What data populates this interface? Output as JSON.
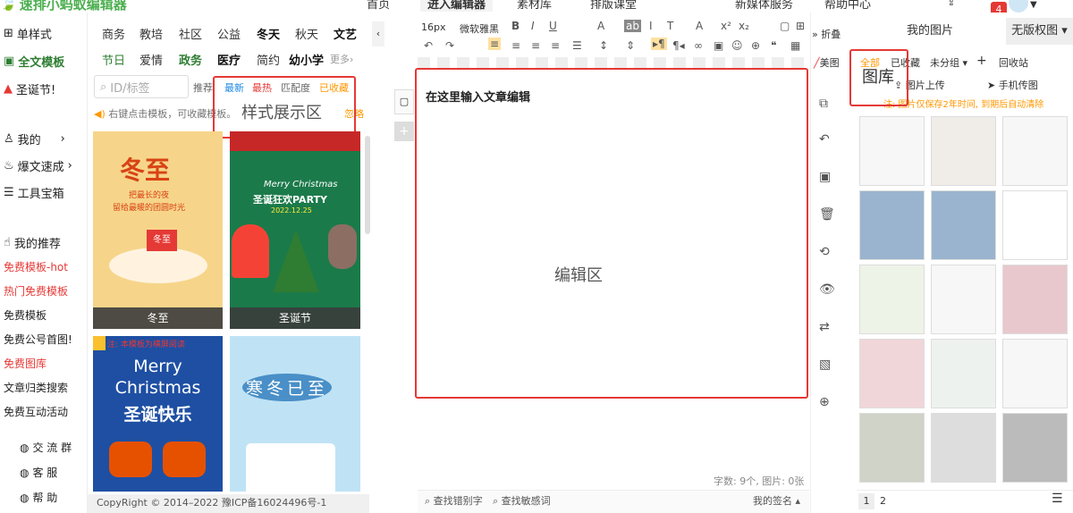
{
  "brand": "速排小蚂蚁编辑器",
  "topnav": [
    "首页",
    "进入编辑器",
    "素材库",
    "排版课堂",
    "新媒体服务",
    "帮助中心"
  ],
  "notif": "4",
  "sidebar": {
    "items": [
      "单样式",
      "全文模板",
      "圣诞节!",
      "我的",
      "爆文速成",
      "工具宝箱",
      "我的推荐",
      "免费模板-hot",
      "热门免费模板",
      "免费模板",
      "免费公号首图!",
      "免费图库",
      "文章归类搜索",
      "免费互动活动",
      "交 流 群",
      "客  服",
      "帮  助"
    ]
  },
  "categories": {
    "row1": [
      "商务",
      "教培",
      "社区",
      "公益",
      "冬天",
      "秋天",
      "文艺"
    ],
    "row2": [
      "节日",
      "爱情",
      "政务",
      "医疗",
      "简约",
      "幼小学",
      "更多"
    ]
  },
  "search": {
    "placeholder": "ID/标签",
    "tabs": [
      "推荐",
      "最新",
      "最热",
      "匹配度",
      "已收藏"
    ]
  },
  "hint": "右键点击模板，可收藏模板。",
  "hint_tail": "忽略",
  "overlay_label_tpl": "样式展示区",
  "cards": [
    {
      "label": "冬至",
      "title": "冬至",
      "sub1": "把最长的夜",
      "sub2": "留给最暖的团圆时光"
    },
    {
      "label": "圣诞节",
      "title": "Merry Christmas",
      "sub1": "圣诞狂欢PARTY",
      "sub2": "2022.12.25"
    },
    {
      "label": "",
      "title": "Merry Christmas",
      "sub1": "圣诞快乐",
      "sub2": "注: 本模板为横屏阅读"
    },
    {
      "label": "",
      "title": "寒冬已至",
      "sub1": "",
      "sub2": ""
    }
  ],
  "copyright": "CopyRight © 2014–2022 豫ICP备16024496号-1",
  "editor": {
    "font_size": "16px",
    "font_family": "微软雅黑",
    "placeholder": "在这里输入文章编辑",
    "overlay_label": "编辑区",
    "count": "字数: 9个, 图片: 0张",
    "find_typo": "查找错别字",
    "find_sensitive": "查找敏感词",
    "signature": "我的签名"
  },
  "tools": {
    "fold": "折叠",
    "meitu": "美图"
  },
  "gallery": {
    "tabs": [
      "我的图片",
      "无版权图"
    ],
    "filters": [
      "全部",
      "已收藏",
      "未分组",
      "回收站"
    ],
    "upload": "图片上传",
    "mobile": "手机传图",
    "notice": "注: 图片仅保存2年时间, 到期后自动清除",
    "overlay_label": "图库",
    "pages": [
      "1",
      "2"
    ]
  },
  "colors": {
    "brand": "#4caf50",
    "red": "#e53935",
    "orange": "#ff9800"
  }
}
